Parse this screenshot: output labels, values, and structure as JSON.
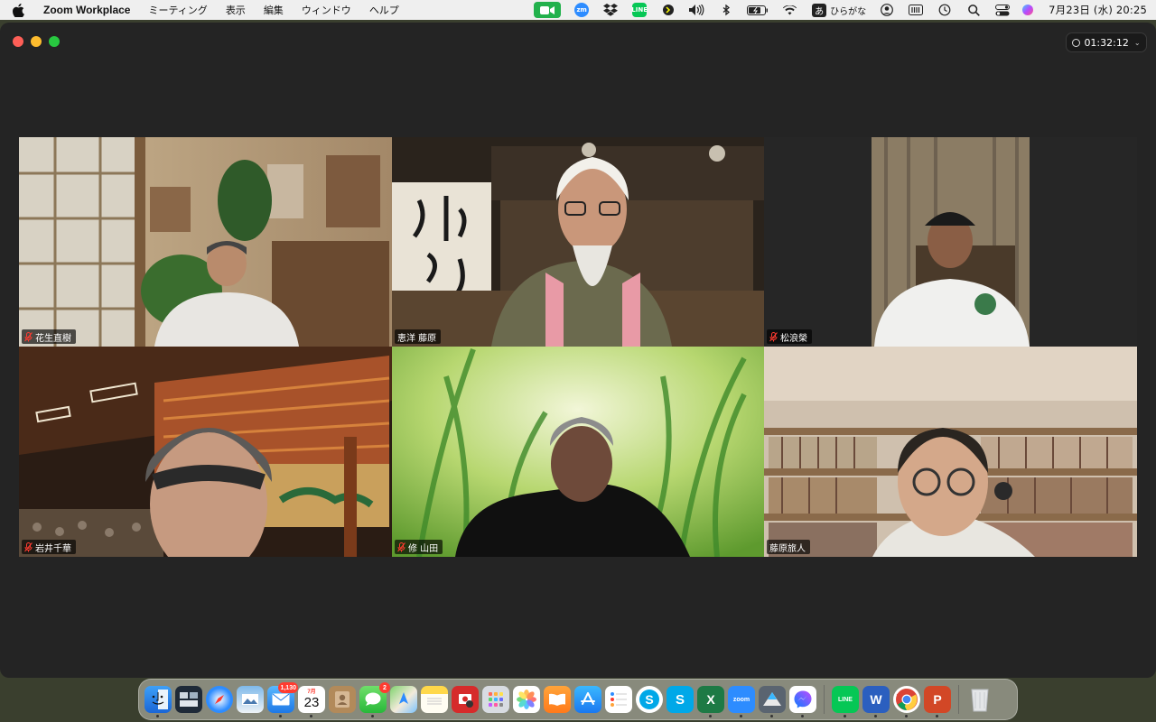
{
  "menubar": {
    "app_name": "Zoom Workplace",
    "menus": [
      "ミーティング",
      "表示",
      "編集",
      "ウィンドウ",
      "ヘルプ"
    ],
    "ime_char": "あ",
    "ime_label": "ひらがな",
    "clock": "7月23日 (水)  20:25",
    "tray_icons": [
      "zoom-video-icon",
      "zoom-zm-icon",
      "dropbox-icon",
      "line-icon",
      "weather-icon",
      "volume-icon",
      "bluetooth-icon",
      "battery-icon",
      "wifi-icon",
      "ime-icon",
      "user-icon",
      "memory-icon",
      "time-machine-icon",
      "search-icon",
      "control-center-icon",
      "siri-icon"
    ],
    "zm_label": "zm",
    "line_label": "LINE"
  },
  "window": {
    "timer": "01:32:12"
  },
  "participants": [
    {
      "name": "花生直樹",
      "muted": true
    },
    {
      "name": "恵洋 藤原",
      "muted": false
    },
    {
      "name": "松浪榮",
      "muted": true
    },
    {
      "name": "岩井千華",
      "muted": true
    },
    {
      "name": "修 山田",
      "muted": true
    },
    {
      "name": "藤原旅人",
      "muted": false,
      "active_speaker": true
    }
  ],
  "colors": {
    "active_speaker": "#35c759",
    "mic_muted": "#ff3b30"
  },
  "dock": {
    "items": [
      {
        "name": "finder-icon",
        "running": true
      },
      {
        "name": "mission-control-icon",
        "running": false
      },
      {
        "name": "safari-icon",
        "running": false
      },
      {
        "name": "preview-icon",
        "running": false
      },
      {
        "name": "mail-icon",
        "badge": "1,130",
        "running": true
      },
      {
        "name": "calendar-icon",
        "label": "23",
        "month": "7月",
        "running": true
      },
      {
        "name": "contacts-icon",
        "running": false
      },
      {
        "name": "messages-icon",
        "badge": "2",
        "running": true
      },
      {
        "name": "maps-icon",
        "running": false
      },
      {
        "name": "notes-icon",
        "running": false
      },
      {
        "name": "photo-booth-icon",
        "running": false
      },
      {
        "name": "launchpad-icon",
        "running": false
      },
      {
        "name": "photos-icon",
        "running": false
      },
      {
        "name": "books-icon",
        "running": false
      },
      {
        "name": "app-store-icon",
        "running": false
      },
      {
        "name": "reminders-icon",
        "running": false
      },
      {
        "name": "skype-icon",
        "running": false
      },
      {
        "name": "skype-alt-icon",
        "running": false
      },
      {
        "name": "excel-icon",
        "label": "X",
        "running": true
      },
      {
        "name": "zoom-icon",
        "label": "zoom",
        "running": true
      },
      {
        "name": "drive-icon",
        "running": true
      },
      {
        "name": "messenger-icon",
        "running": true
      },
      {
        "name": "line-dock-icon",
        "label": "LINE",
        "running": true
      },
      {
        "name": "word-icon",
        "label": "W",
        "running": true
      },
      {
        "name": "chrome-icon",
        "running": true
      },
      {
        "name": "powerpoint-icon",
        "label": "P",
        "running": true
      },
      {
        "name": "trash-icon",
        "running": false
      }
    ]
  }
}
